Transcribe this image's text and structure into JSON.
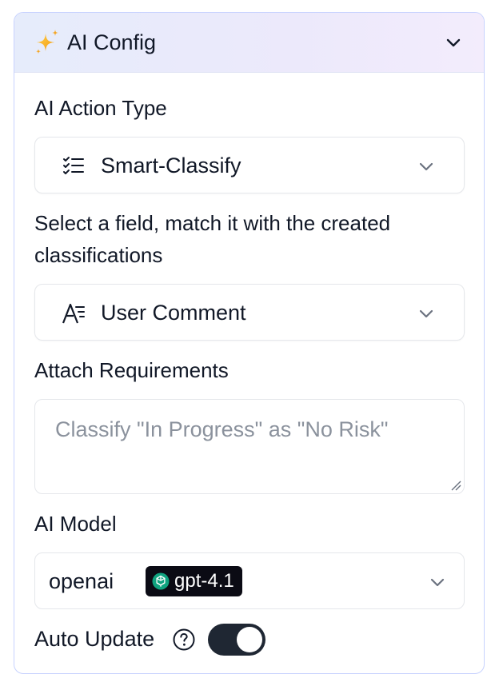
{
  "header": {
    "title": "AI Config"
  },
  "action_type": {
    "label": "AI Action Type",
    "value": "Smart-Classify"
  },
  "field": {
    "label": "Select a field, match it with the created classifications",
    "label_line1": "Select a field, match it with the created",
    "label_line2": "classifications",
    "value": "User Comment"
  },
  "requirements": {
    "label": "Attach Requirements",
    "placeholder": "Classify \"In Progress\" as \"No Risk\""
  },
  "model": {
    "label": "AI Model",
    "provider": "openai",
    "name": "gpt-4.1"
  },
  "auto_update": {
    "label": "Auto Update",
    "enabled": true
  },
  "colors": {
    "panel_border": "#c7d2fe",
    "toggle_on": "#1f2733",
    "sparkle": "#f5a623"
  }
}
